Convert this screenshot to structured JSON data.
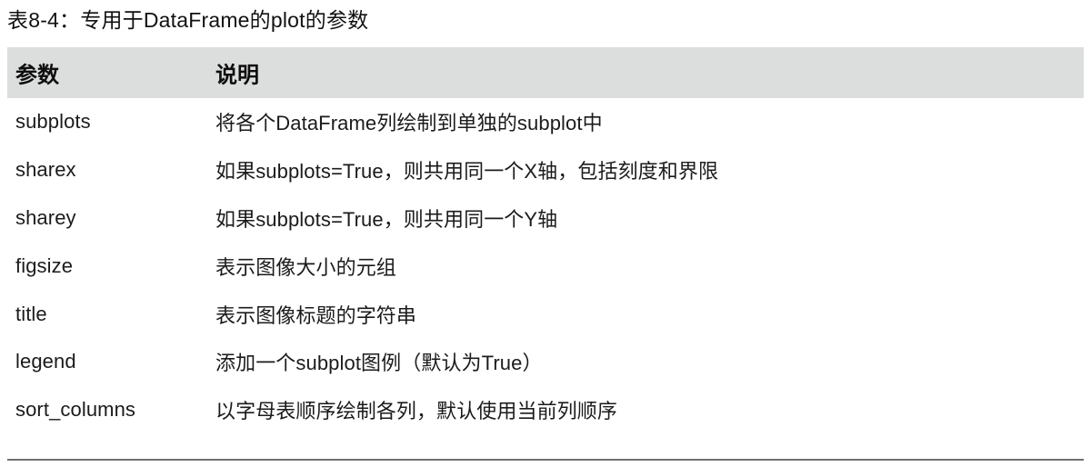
{
  "caption": "表8-4：专用于DataFrame的plot的参数",
  "table": {
    "columns": [
      "参数",
      "说明"
    ],
    "rows": [
      {
        "param": "subplots",
        "desc": "将各个DataFrame列绘制到单独的subplot中"
      },
      {
        "param": "sharex",
        "desc": "如果subplots=True，则共用同一个X轴，包括刻度和界限"
      },
      {
        "param": "sharey",
        "desc": "如果subplots=True，则共用同一个Y轴"
      },
      {
        "param": "figsize",
        "desc": "表示图像大小的元组"
      },
      {
        "param": "title",
        "desc": "表示图像标题的字符串"
      },
      {
        "param": "legend",
        "desc": "添加一个subplot图例（默认为True）"
      },
      {
        "param": "sort_columns",
        "desc": "以字母表顺序绘制各列，默认使用当前列顺序"
      }
    ]
  },
  "colors": {
    "header_band": "#dcdedd",
    "bottom_rule": "#6e7173",
    "text": "#1b1b1b",
    "page_background": "#ffffff"
  }
}
